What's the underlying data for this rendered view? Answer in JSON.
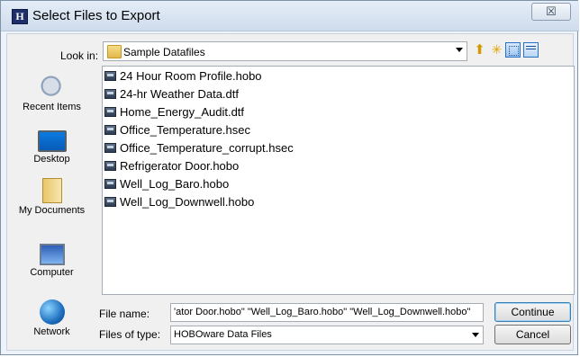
{
  "window": {
    "title": "Select Files to Export",
    "app_icon": "H",
    "close_symbol": "☒"
  },
  "toolbar": {
    "look_in_label": "Look in:",
    "look_in_value": "Sample Datafiles",
    "icons": [
      "up-one-level-icon",
      "new-folder-icon",
      "view-menu-icon",
      "details-view-icon"
    ]
  },
  "places": [
    {
      "label": "Recent Items",
      "icon": "recent-items-icon"
    },
    {
      "label": "Desktop",
      "icon": "desktop-icon"
    },
    {
      "label": "My Documents",
      "icon": "documents-icon"
    },
    {
      "label": "Computer",
      "icon": "computer-icon"
    },
    {
      "label": "Network",
      "icon": "network-icon"
    }
  ],
  "files": [
    "24 Hour Room Profile.hobo",
    "24-hr Weather Data.dtf",
    "Home_Energy_Audit.dtf",
    "Office_Temperature.hsec",
    "Office_Temperature_corrupt.hsec",
    "Refrigerator Door.hobo",
    "Well_Log_Baro.hobo",
    "Well_Log_Downwell.hobo"
  ],
  "form": {
    "file_name_label": "File name:",
    "file_name_value": "'ator Door.hobo\" \"Well_Log_Baro.hobo\" \"Well_Log_Downwell.hobo\"",
    "file_type_label": "Files of type:",
    "file_type_value": "HOBOware Data Files"
  },
  "buttons": {
    "continue": "Continue",
    "cancel": "Cancel"
  }
}
